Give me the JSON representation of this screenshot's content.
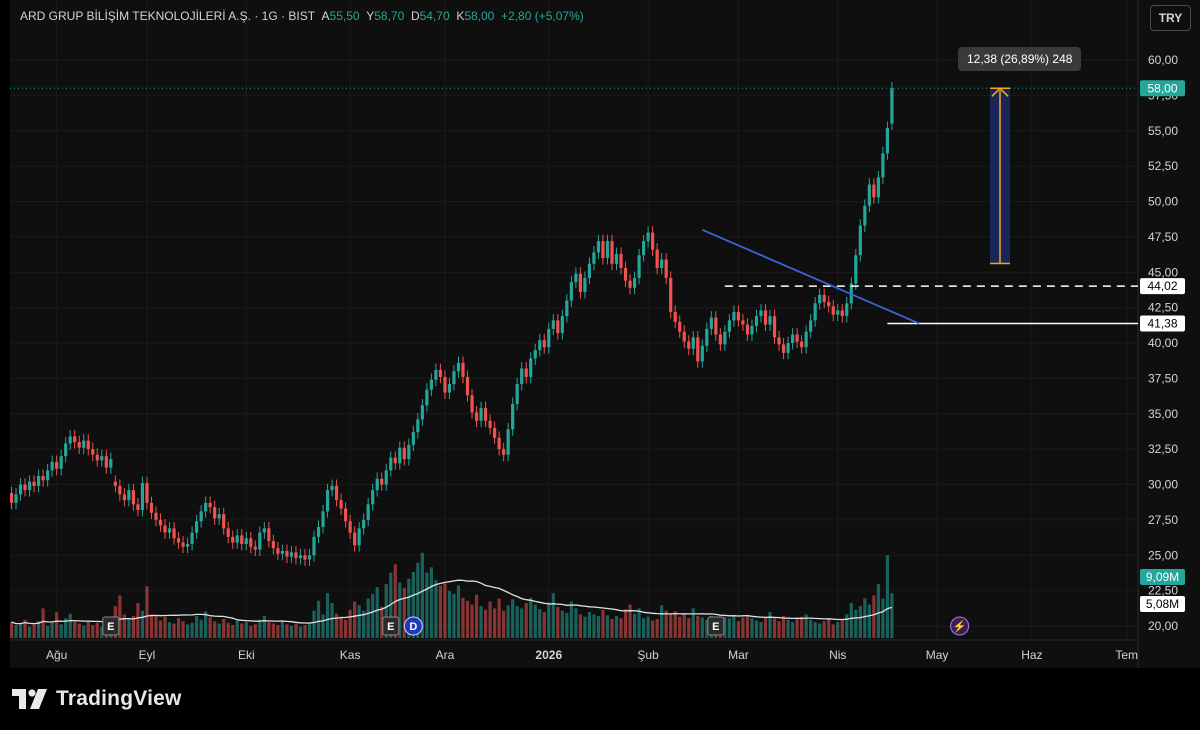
{
  "header": {
    "symbol": "ARD GRUP BİLİŞİM TEKNOLOJİLERİ A.Ş.",
    "interval": "1G",
    "exchange": "BIST",
    "separator": "·",
    "open_label": "A",
    "open_value": "55,50",
    "high_label": "Y",
    "high_value": "58,70",
    "low_label": "D",
    "low_value": "54,70",
    "close_label": "K",
    "close_value": "58,00",
    "change_text": "+2,80 (+5,07%)",
    "currency_button": "TRY"
  },
  "measure": {
    "tooltip": "12,38 (26,89%) 248",
    "from_price": 45.62,
    "to_price": 58.0
  },
  "branding": {
    "name": "TradingView"
  },
  "colors": {
    "up": "#26a69a",
    "down": "#ef5350",
    "trendline": "#3d63dd",
    "measure_fill": "#1c2a63",
    "measure_arrow": "#f5a623",
    "ma": "#e0e0e0"
  },
  "chart_data": {
    "type": "candlestick",
    "title": "ARD GRUP BİLİŞİM TEKNOLOJİLERİ A.Ş. · 1G · BIST",
    "y_ticks": [
      "20,00",
      "22,50",
      "25,00",
      "27,50",
      "30,00",
      "32,50",
      "35,00",
      "37,50",
      "40,00",
      "42,50",
      "45,00",
      "47,50",
      "50,00",
      "52,50",
      "55,00",
      "57,50",
      "60,00"
    ],
    "ylim": [
      19.5,
      61.5
    ],
    "x_ticks": [
      {
        "label": "Ağu",
        "bar": 10,
        "bold": false
      },
      {
        "label": "Eyl",
        "bar": 30,
        "bold": false
      },
      {
        "label": "Eki",
        "bar": 52,
        "bold": false
      },
      {
        "label": "Kas",
        "bar": 75,
        "bold": false
      },
      {
        "label": "Ara",
        "bar": 96,
        "bold": false
      },
      {
        "label": "2026",
        "bar": 119,
        "bold": true
      },
      {
        "label": "Şub",
        "bar": 141,
        "bold": false
      },
      {
        "label": "Mar",
        "bar": 161,
        "bold": false
      },
      {
        "label": "Nis",
        "bar": 183,
        "bold": false
      },
      {
        "label": "May",
        "bar": 205,
        "bold": false
      },
      {
        "label": "Haz",
        "bar": 226,
        "bold": false
      },
      {
        "label": "Tem",
        "bar": 247,
        "bold": false
      }
    ],
    "series": [
      {
        "name": "close",
        "values": [
          28.7,
          29.3,
          30.0,
          29.6,
          30.2,
          29.9,
          30.6,
          30.3,
          31.0,
          31.6,
          31.1,
          32.0,
          32.9,
          33.4,
          33.0,
          32.6,
          33.1,
          32.5,
          32.1,
          31.7,
          32.0,
          31.2,
          31.8,
          29.9,
          29.3,
          28.9,
          29.6,
          28.6,
          28.2,
          30.1,
          28.7,
          28.0,
          27.5,
          27.1,
          26.6,
          26.9,
          26.2,
          25.9,
          25.6,
          25.8,
          26.6,
          27.4,
          28.1,
          28.7,
          28.4,
          27.6,
          27.9,
          26.9,
          26.3,
          25.9,
          26.4,
          25.8,
          26.2,
          25.6,
          25.4,
          26.6,
          26.9,
          26.0,
          25.5,
          25.1,
          25.3,
          24.9,
          25.2,
          24.8,
          25.0,
          24.7,
          25.0,
          26.3,
          27.0,
          28.1,
          29.6,
          29.9,
          28.9,
          28.3,
          27.4,
          26.6,
          25.7,
          26.9,
          27.5,
          28.6,
          29.6,
          30.4,
          30.0,
          31.0,
          31.9,
          31.5,
          32.6,
          31.8,
          32.8,
          33.7,
          34.6,
          35.6,
          36.7,
          37.4,
          38.1,
          37.6,
          36.5,
          37.1,
          38.0,
          38.6,
          37.6,
          36.3,
          35.1,
          34.5,
          35.4,
          34.5,
          34.0,
          33.3,
          32.5,
          32.1,
          33.9,
          35.7,
          37.1,
          38.2,
          37.6,
          38.9,
          39.5,
          40.2,
          39.7,
          41.0,
          41.6,
          40.7,
          41.9,
          43.0,
          44.3,
          44.9,
          43.6,
          44.6,
          45.6,
          46.4,
          47.2,
          46.0,
          47.2,
          45.6,
          46.3,
          45.3,
          44.4,
          43.9,
          44.6,
          46.2,
          47.2,
          47.8,
          46.6,
          45.3,
          45.9,
          44.6,
          42.2,
          41.5,
          40.8,
          40.1,
          39.6,
          40.4,
          38.7,
          39.8,
          41.0,
          41.8,
          40.6,
          39.9,
          40.8,
          41.6,
          42.2,
          41.6,
          41.3,
          40.6,
          41.2,
          41.9,
          42.3,
          41.3,
          41.9,
          40.4,
          39.9,
          39.3,
          40.0,
          40.6,
          40.1,
          39.7,
          40.8,
          41.6,
          42.8,
          43.4,
          42.9,
          42.6,
          42.0,
          42.3,
          41.9,
          42.8,
          44.2,
          46.2,
          48.3,
          49.7,
          51.2,
          50.3,
          51.7,
          53.4,
          55.2,
          58.0
        ]
      }
    ],
    "open_values": [
      29.4,
      28.7,
      29.3,
      30.0,
      29.6,
      30.2,
      29.9,
      30.6,
      30.3,
      31.0,
      31.6,
      31.1,
      32.0,
      32.9,
      33.4,
      33.0,
      32.6,
      33.1,
      32.5,
      32.1,
      31.7,
      32.0,
      31.2,
      30.2,
      29.9,
      29.3,
      28.9,
      29.6,
      28.6,
      28.2,
      30.1,
      28.7,
      28.0,
      27.5,
      27.1,
      26.6,
      26.9,
      26.2,
      25.9,
      25.6,
      25.8,
      26.6,
      27.4,
      28.1,
      28.7,
      28.4,
      27.6,
      27.9,
      26.9,
      26.3,
      25.9,
      26.4,
      25.8,
      26.2,
      25.6,
      25.4,
      26.6,
      26.9,
      26.0,
      25.5,
      25.1,
      25.3,
      24.9,
      25.2,
      24.8,
      25.0,
      24.7,
      25.0,
      26.3,
      27.0,
      28.1,
      29.6,
      29.9,
      28.9,
      28.3,
      27.4,
      26.6,
      25.7,
      26.9,
      27.5,
      28.6,
      29.6,
      30.4,
      30.0,
      31.0,
      31.9,
      31.5,
      32.6,
      31.8,
      32.8,
      33.7,
      34.6,
      35.6,
      36.7,
      37.4,
      38.1,
      37.6,
      36.5,
      37.1,
      38.0,
      38.6,
      37.6,
      36.3,
      35.1,
      34.5,
      35.4,
      34.5,
      34.0,
      33.3,
      32.5,
      32.1,
      33.9,
      35.7,
      37.1,
      38.2,
      37.6,
      38.9,
      39.5,
      40.2,
      39.7,
      41.0,
      41.6,
      40.7,
      41.9,
      43.0,
      44.3,
      44.9,
      43.6,
      44.6,
      45.6,
      46.4,
      47.2,
      46.0,
      47.2,
      45.6,
      46.3,
      45.3,
      44.4,
      43.9,
      44.6,
      46.2,
      47.2,
      47.8,
      46.6,
      45.3,
      45.9,
      44.6,
      42.2,
      41.5,
      40.8,
      40.1,
      39.6,
      40.4,
      38.7,
      39.8,
      41.0,
      41.8,
      40.6,
      39.9,
      40.8,
      41.6,
      42.2,
      41.6,
      41.3,
      40.6,
      41.2,
      41.9,
      42.3,
      41.3,
      41.9,
      40.4,
      39.9,
      39.3,
      40.0,
      40.6,
      40.1,
      39.7,
      40.8,
      41.6,
      42.8,
      43.4,
      42.9,
      42.6,
      42.0,
      42.3,
      41.9,
      42.8,
      44.2,
      46.2,
      48.3,
      49.7,
      51.2,
      50.3,
      51.7,
      53.4,
      55.5
    ],
    "volume_values": [
      2.1,
      1.7,
      1.9,
      2.4,
      1.5,
      1.8,
      2.2,
      3.9,
      1.6,
      2.0,
      3.4,
      1.8,
      2.6,
      3.2,
      2.1,
      1.9,
      1.6,
      2.3,
      1.7,
      2.0,
      1.5,
      1.8,
      2.2,
      4.2,
      5.6,
      3.1,
      2.4,
      2.9,
      4.6,
      3.6,
      6.8,
      3.1,
      2.9,
      2.3,
      2.8,
      2.1,
      1.9,
      2.6,
      2.2,
      1.8,
      2.0,
      2.9,
      2.4,
      3.5,
      2.7,
      2.2,
      1.9,
      2.5,
      2.0,
      1.7,
      2.3,
      1.9,
      2.1,
      1.6,
      1.8,
      2.4,
      2.9,
      2.1,
      1.9,
      1.7,
      2.2,
      1.8,
      1.6,
      1.9,
      1.5,
      1.7,
      2.0,
      3.6,
      4.9,
      3.1,
      5.9,
      4.6,
      3.2,
      2.8,
      2.4,
      3.7,
      4.8,
      4.3,
      3.6,
      5.2,
      5.8,
      6.7,
      4.1,
      7.1,
      8.6,
      9.7,
      7.3,
      6.6,
      7.8,
      8.7,
      9.9,
      11.2,
      8.6,
      9.3,
      7.6,
      6.9,
      7.2,
      6.2,
      5.8,
      6.9,
      5.3,
      4.9,
      4.4,
      5.7,
      4.2,
      3.7,
      4.8,
      3.9,
      5.2,
      3.6,
      4.3,
      5.1,
      4.2,
      3.9,
      4.6,
      5.3,
      4.4,
      3.8,
      3.4,
      4.7,
      5.9,
      4.1,
      3.6,
      3.3,
      4.8,
      3.9,
      3.1,
      2.8,
      3.4,
      3.1,
      2.9,
      3.7,
      3.0,
      2.5,
      2.9,
      2.6,
      3.8,
      4.4,
      3.2,
      3.9,
      2.6,
      2.8,
      2.3,
      2.5,
      4.3,
      3.6,
      3.1,
      3.5,
      2.8,
      3.2,
      2.6,
      3.9,
      2.9,
      2.7,
      2.4,
      2.9,
      2.5,
      2.3,
      2.8,
      2.6,
      2.9,
      2.2,
      2.7,
      3.0,
      2.6,
      2.3,
      2.1,
      2.7,
      3.4,
      2.6,
      2.2,
      2.9,
      2.4,
      2.1,
      2.6,
      2.8,
      3.1,
      2.4,
      2.1,
      1.9,
      2.2,
      2.5,
      1.8,
      2.1,
      2.4,
      3.1,
      4.6,
      3.7,
      4.2,
      5.2,
      4.4,
      5.6,
      7.1,
      5.2,
      10.9,
      5.9
    ],
    "volume_max": 12.5,
    "ma_label": "5,08M",
    "volume_label": "9,09M",
    "price_labels": [
      {
        "text": "58,00",
        "value": 58.0,
        "kind": "last"
      },
      {
        "text": "44,02",
        "value": 44.02,
        "kind": "level"
      },
      {
        "text": "41,38",
        "value": 41.38,
        "kind": "level"
      }
    ],
    "trendline": {
      "from_bar": 153,
      "from_price": 48.0,
      "to_bar": 201,
      "to_price": 41.38
    },
    "levels": [
      {
        "price": 44.02,
        "from_bar": 158,
        "style": "dashed"
      },
      {
        "price": 41.38,
        "from_bar": 194,
        "style": "solid"
      }
    ],
    "event_markers": [
      {
        "label": "E",
        "bar": 22
      },
      {
        "label": "E",
        "bar": 84
      },
      {
        "label": "D",
        "bar": 89
      },
      {
        "label": "E",
        "bar": 156
      },
      {
        "label": "⚡",
        "bar": 210
      }
    ]
  }
}
